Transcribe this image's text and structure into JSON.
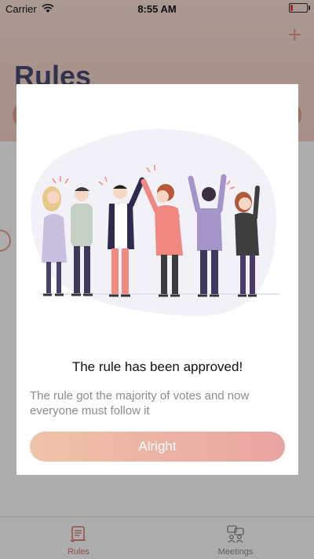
{
  "status_bar": {
    "carrier": "Carrier",
    "time": "8:55 AM",
    "battery_level": 0.15
  },
  "header": {
    "title": "Rules",
    "add_icon": "plus-icon"
  },
  "modal": {
    "title": "The rule has been approved!",
    "message": "The rule got the majority of votes and now everyone must follow it",
    "button_label": "Alright",
    "illustration": "people-celebrating-illustration"
  },
  "tab_bar": {
    "items": [
      {
        "label": "Rules",
        "icon": "scroll-icon",
        "active": true
      },
      {
        "label": "Meetings",
        "icon": "meetings-icon",
        "active": false
      }
    ]
  },
  "colors": {
    "accent": "#e8a08f",
    "title": "#4b4a75",
    "active_tab": "#d9756a",
    "button_start": "#f0c3a8",
    "button_end": "#e9a4a1"
  }
}
